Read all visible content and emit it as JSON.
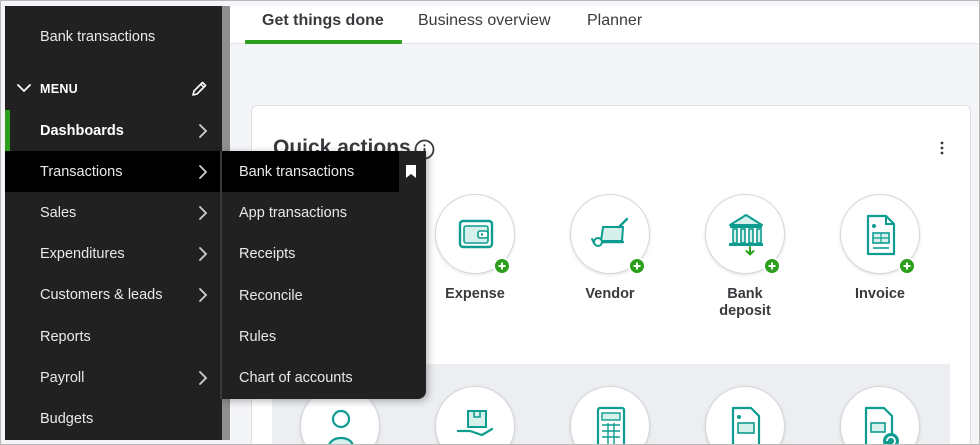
{
  "sidebar": {
    "top_item": "Bank transactions",
    "menu_header": "MENU",
    "items": [
      {
        "label": "Dashboards",
        "has_chevron": true,
        "active": true
      },
      {
        "label": "Transactions",
        "has_chevron": true,
        "hover": true
      },
      {
        "label": "Sales",
        "has_chevron": true
      },
      {
        "label": "Expenditures",
        "has_chevron": true
      },
      {
        "label": "Customers & leads",
        "has_chevron": true
      },
      {
        "label": "Reports",
        "has_chevron": false
      },
      {
        "label": "Payroll",
        "has_chevron": true
      },
      {
        "label": "Budgets",
        "has_chevron": false
      }
    ]
  },
  "flyout": {
    "items": [
      {
        "label": "Bank transactions",
        "bookmarked": true
      },
      {
        "label": "App transactions"
      },
      {
        "label": "Receipts"
      },
      {
        "label": "Reconcile"
      },
      {
        "label": "Rules"
      },
      {
        "label": "Chart of accounts"
      }
    ]
  },
  "tabs": [
    {
      "label": "Get things done",
      "selected": true
    },
    {
      "label": "Business overview"
    },
    {
      "label": "Planner"
    }
  ],
  "quick_actions": {
    "title": "Quick actions",
    "actions": [
      {
        "label_line1": "Expense",
        "label_line2": "",
        "icon": "wallet-icon"
      },
      {
        "label_line1": "Vendor",
        "label_line2": "",
        "icon": "hand-truck-icon"
      },
      {
        "label_line1": "Bank",
        "label_line2": "deposit",
        "icon": "bank-icon"
      },
      {
        "label_line1": "Invoice",
        "label_line2": "",
        "icon": "invoice-icon"
      }
    ]
  },
  "colors": {
    "accent": "#2ca01c",
    "sidebar_bg": "#212121",
    "icon_teal": "#0d9c8f"
  }
}
